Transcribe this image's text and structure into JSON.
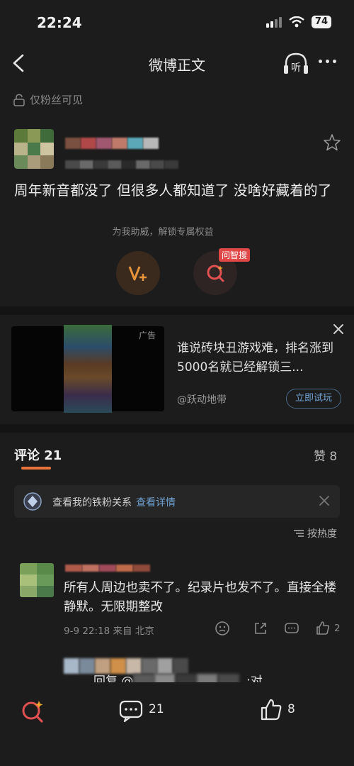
{
  "status_bar": {
    "time": "22:24",
    "battery": "74"
  },
  "header": {
    "title": "微博正文",
    "listen_label": "听"
  },
  "visibility": {
    "label": "仅粉丝可见"
  },
  "post": {
    "text": "周年新音都没了 但很多人都知道了 没啥好藏着的了",
    "support_text": "为我助威，解锁专属权益",
    "ask_badge": "问智搜"
  },
  "ad": {
    "label": "广告",
    "title": "谁说砖块丑游戏难，排名涨到5000名就已经解锁三...",
    "source": "@跃动地带",
    "cta": "立即试玩"
  },
  "comments": {
    "tab_label": "评论 21",
    "likes_label": "赞 8",
    "fan_banner": {
      "text": "查看我的铁粉关系",
      "link": "查看详情"
    },
    "sort_label": "按热度",
    "items": [
      {
        "text": "所有人周边也卖不了。纪录片也发不了。直接全楼静默。无限期整改",
        "meta": "9-9 22:18 来自 北京",
        "like_count": "2",
        "reply_prefix": "回复 @",
        "reply_suffix": ":对"
      }
    ]
  },
  "bottom_bar": {
    "comment_count": "21",
    "like_count": "8"
  },
  "colors": {
    "accent": "#e8743a",
    "link": "#6ea0d0",
    "background": "#1c1c1c",
    "badge": "#e04848"
  }
}
